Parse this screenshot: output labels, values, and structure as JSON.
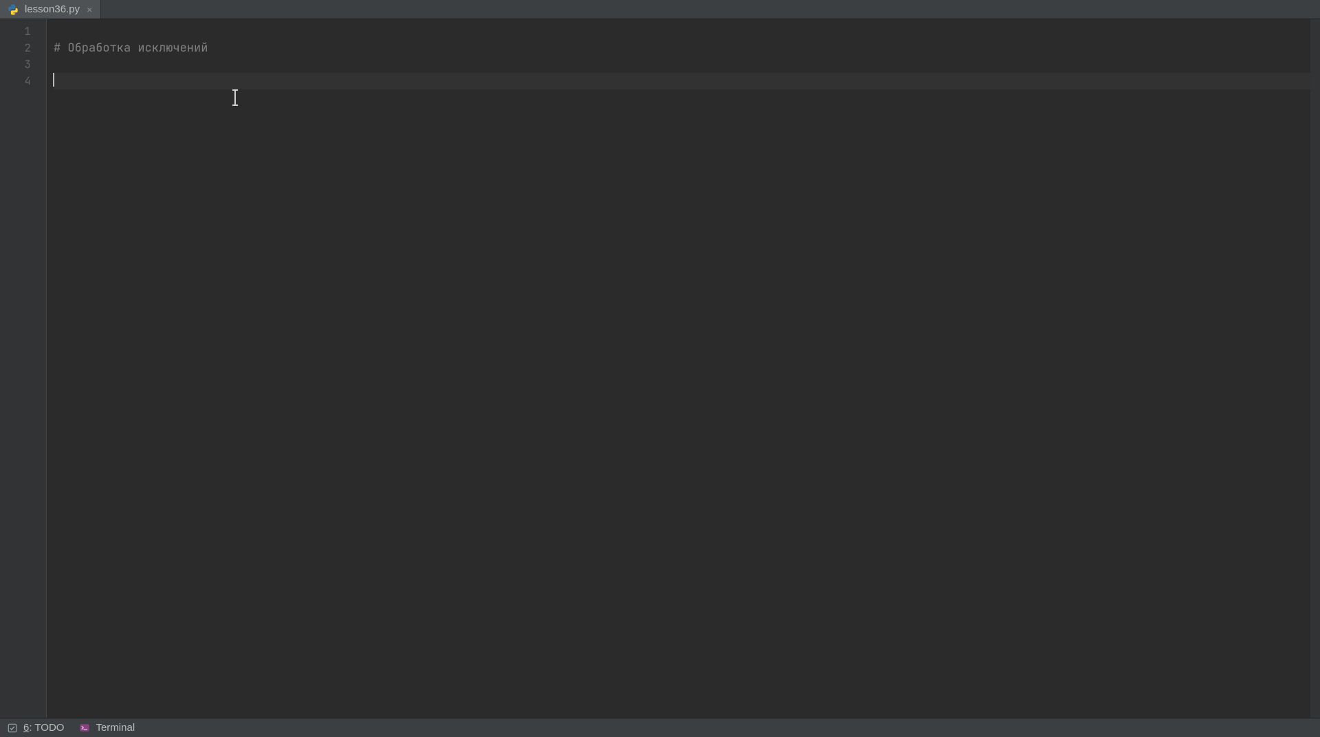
{
  "tab": {
    "filename": "lesson36.py",
    "icon": "python-file-icon",
    "close_glyph": "×"
  },
  "editor": {
    "lines": [
      {
        "n": "1",
        "text": ""
      },
      {
        "n": "2",
        "text": "# Обработка исключений"
      },
      {
        "n": "3",
        "text": ""
      },
      {
        "n": "4",
        "text": ""
      }
    ],
    "current_line_index": 3
  },
  "bottombar": {
    "todo_prefix": "6",
    "todo_rest": ": TODO",
    "terminal_label": "Terminal"
  },
  "icons": {
    "python": "python-file-icon",
    "todo": "todo-icon",
    "terminal": "terminal-icon"
  },
  "colors": {
    "bg": "#2b2b2b",
    "panel": "#3c3f41",
    "gutter": "#313335",
    "comment": "#808080",
    "line_number": "#606366",
    "text": "#bbbbbb"
  }
}
